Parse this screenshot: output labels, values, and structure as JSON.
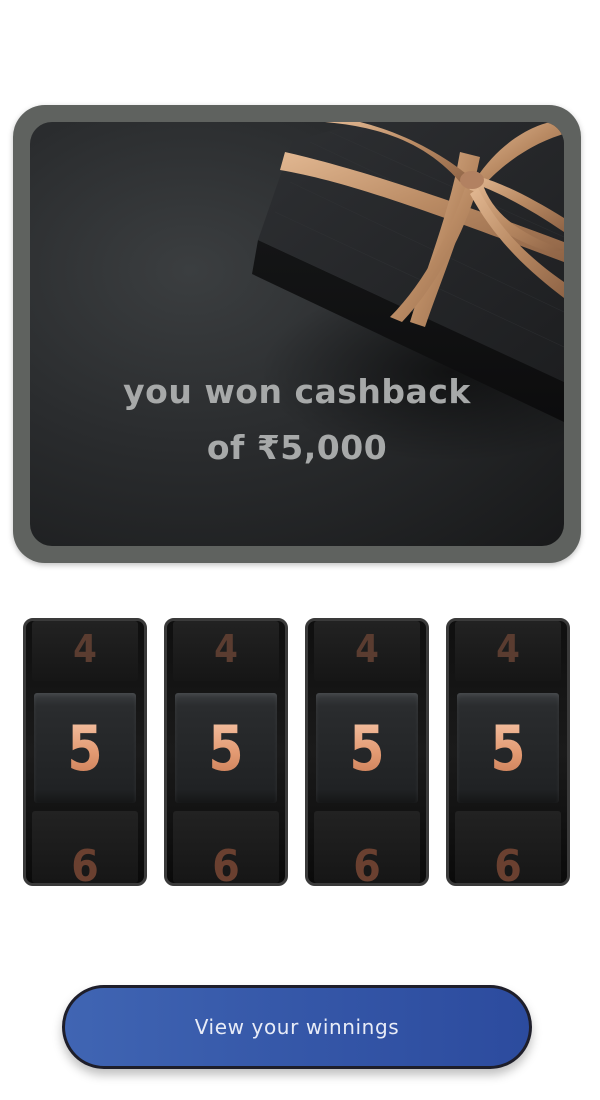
{
  "reward_card": {
    "line1": "you won cashback",
    "line2": "of ₹5,000"
  },
  "reels": [
    {
      "prev": "4",
      "current": "5",
      "next": "6"
    },
    {
      "prev": "4",
      "current": "5",
      "next": "6"
    },
    {
      "prev": "4",
      "current": "5",
      "next": "6"
    },
    {
      "prev": "4",
      "current": "5",
      "next": "6"
    }
  ],
  "cta": {
    "label": "View your winnings"
  },
  "colors": {
    "card_frame": "#5f625f",
    "card_text": "#a7a9a9",
    "digit_copper": "#e39a72",
    "button_blue": "#3557a8"
  }
}
